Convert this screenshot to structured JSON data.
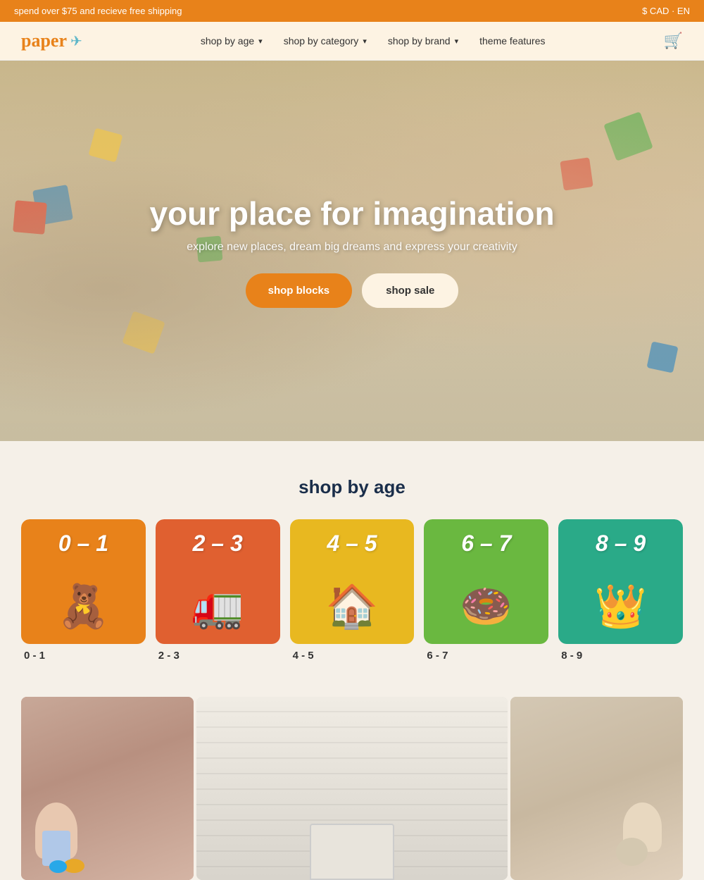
{
  "topBanner": {
    "leftText": "spend over $75 and recieve free shipping",
    "rightText": "$ CAD · EN"
  },
  "header": {
    "logoText": "paper",
    "logoIcon": "✈",
    "nav": [
      {
        "label": "shop by age",
        "hasDropdown": true,
        "id": "shop-by-age"
      },
      {
        "label": "shop by category",
        "hasDropdown": true,
        "id": "shop-by-category"
      },
      {
        "label": "shop by brand",
        "hasDropdown": true,
        "id": "shop-by-brand"
      },
      {
        "label": "theme features",
        "hasDropdown": false,
        "id": "theme-features"
      }
    ],
    "cartLabel": "🛒"
  },
  "hero": {
    "title": "your place for imagination",
    "subtitle": "explore new places, dream big dreams and express your creativity",
    "btnPrimary": "shop blocks",
    "btnSecondary": "shop sale"
  },
  "shopByAge": {
    "sectionTitle": "shop by age",
    "cards": [
      {
        "range": "0 – 1",
        "emoji": "🧸",
        "bg": "#e8821a",
        "label": "0 - 1"
      },
      {
        "range": "2 – 3",
        "emoji": "🚛",
        "bg": "#e06030",
        "label": "2 - 3"
      },
      {
        "range": "4 – 5",
        "emoji": "🏠",
        "bg": "#e8b820",
        "label": "4 - 5"
      },
      {
        "range": "6 – 7",
        "emoji": "🍩",
        "bg": "#6ab840",
        "label": "6 - 7"
      },
      {
        "range": "8 – 9",
        "emoji": "👑",
        "bg": "#2aaa88",
        "label": "8 - 9"
      }
    ]
  },
  "photos": {
    "items": [
      {
        "id": "photo-left",
        "alt": "child playing with toys"
      },
      {
        "id": "photo-center",
        "alt": "room with white wall"
      },
      {
        "id": "photo-right",
        "alt": "girl crafting"
      }
    ]
  }
}
